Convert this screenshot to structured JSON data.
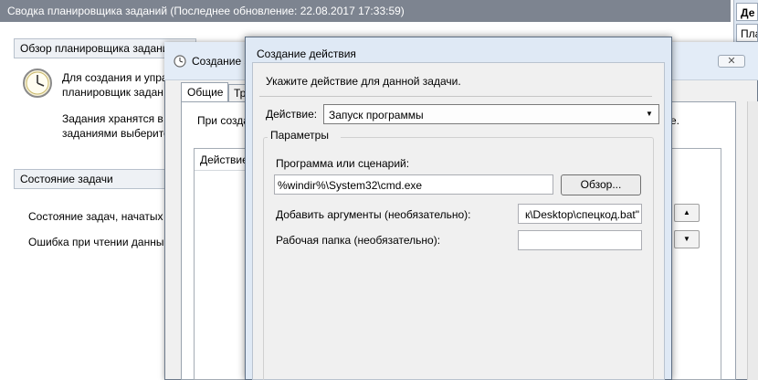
{
  "background": {
    "title": "Сводка планировщика заданий (Последнее обновление: 22.08.2017 17:33:59)",
    "right_tab_1": "Де",
    "right_tab_2": "Пла",
    "overview_header": "Обзор планировщика задани",
    "overview_text_line1": "Для создания и упра",
    "overview_text_line2": "планировщик задан",
    "overview_text_line3": "Задания хранятся в п",
    "overview_text_line4": "заданиями выберите",
    "status_header": "Состояние задачи",
    "status_text1": "Состояние задач, начатых в",
    "status_text2": "Ошибка при чтении данны"
  },
  "task_dialog": {
    "title": "Создание з",
    "tabs": [
      "Общие",
      "Тр"
    ],
    "text_left": "При созда",
    "text_right": "е.",
    "actions_column": "Действие",
    "up_arrow": "▲",
    "down_arrow": "▼",
    "close_symbol": "✕"
  },
  "action_dialog": {
    "title": "Создание действия",
    "instruction": "Укажите действие для данной задачи.",
    "action_label": "Действие:",
    "action_value": "Запуск программы",
    "params_label": "Параметры",
    "program_label": "Программа или сценарий:",
    "program_value": "%windir%\\System32\\cmd.exe",
    "browse_label": "Обзор...",
    "args_label": "Добавить аргументы (необязательно):",
    "args_value": "к\\Desktop\\спецкод.bat\"",
    "workdir_label": "Рабочая папка (необязательно):",
    "workdir_value": ""
  }
}
